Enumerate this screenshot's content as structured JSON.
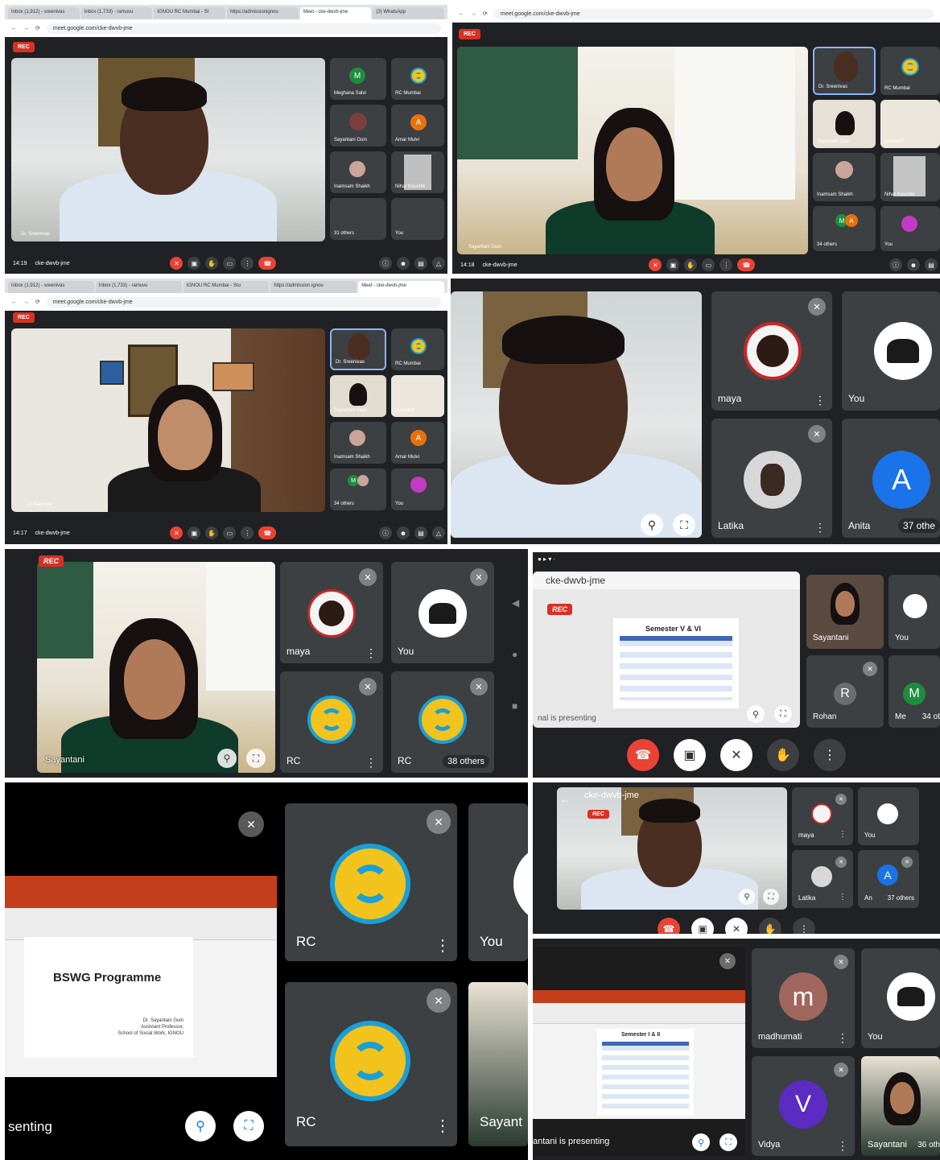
{
  "panel1": {
    "tabs": [
      "Inbox (1,912) - sreenivas",
      "Inbox (1,733) - ramuvu",
      "IGNOU RC Mumbai - St",
      "https://admissionignou",
      "Meet - cke-dwvb-jme",
      "(3) WhatsApp"
    ],
    "url": "meet.google.com/cke-dwvb-jme",
    "rec": "REC",
    "tiles": [
      {
        "name": "Meghana Salvi",
        "initial": "M",
        "color": "#1e8e3e"
      },
      {
        "name": "RC Mumbai",
        "initial": "",
        "color": "#3c4043"
      },
      {
        "name": "Sayantani Guin",
        "initial": "",
        "color": "#3c4043"
      },
      {
        "name": "Amar Mulvi",
        "initial": "A",
        "color": "#e8710a"
      },
      {
        "name": "Inamsam Shaikh",
        "initial": "",
        "color": "#3c4043"
      },
      {
        "name": "Nihar Kaushik",
        "initial": "",
        "color": "#3c4043"
      },
      {
        "name": "31 others",
        "initial": "",
        "color": "#3c4043"
      },
      {
        "name": "You",
        "initial": "",
        "color": "#3c4043"
      }
    ],
    "meeting_code": "cke-dwvb-jme",
    "time": "14:19"
  },
  "panel2": {
    "url": "meet.google.com/cke-dwvb-jme",
    "rec": "REC",
    "tiles": [
      "Dr. Sreenivas",
      "RC Mumbai",
      "Sayantani Guin",
      "prashant",
      "Inamsam Shaikh",
      "Nihar Kaushik",
      "34 others",
      "You"
    ],
    "main_name": "Sayantani Guin",
    "meeting_code": "cke-dwvb-jme",
    "time": "14:18"
  },
  "panel3": {
    "tabs": [
      "Inbox (1,912) - sreenivas",
      "Inbox (1,733) - ramuvu",
      "IGNOU RC Mumbai - Stu",
      "https://admission.ignou",
      "Meet - cke-dwvb-jme"
    ],
    "url": "meet.google.com/cke-dwvb-jme",
    "rec": "REC",
    "tiles": [
      "Dr. Sreenivas",
      "RC Mumbai",
      "Sayantani Guin",
      "prashant",
      "Inamsam Shaikh",
      "Amar Mulvi",
      "34 others",
      "You"
    ],
    "main_name": "Dr Saumya",
    "meeting_code": "cke-dwvb-jme",
    "time": "14:17"
  },
  "panel4": {
    "tiles": [
      {
        "name": "maya"
      },
      {
        "name": "You"
      },
      {
        "name": "Latika"
      },
      {
        "name": "Anita",
        "initial": "A",
        "others": "37 othe"
      }
    ]
  },
  "panel5": {
    "rec": "REC",
    "main_name": "Sayantani",
    "tiles": [
      {
        "name": "maya"
      },
      {
        "name": "You"
      },
      {
        "name": "RC"
      },
      {
        "name": "RC",
        "others": "38 others"
      }
    ]
  },
  "panel6": {
    "meeting_code": "cke-dwvb-jme",
    "rec": "REC",
    "slide_title": "Semester V & VI",
    "presenting": "nal is presenting",
    "tiles": [
      {
        "name": "Sayantani"
      },
      {
        "name": "You"
      },
      {
        "name": "Rohan",
        "initial": "R"
      },
      {
        "name": "Me",
        "initial": "M",
        "others": "34 ot"
      }
    ]
  },
  "panel7": {
    "ppt_title": "BSWG Programme",
    "ppt_sub": [
      "Dr. Sayantani Guin",
      "Assistant Professor,",
      "School of Social Work, IGNOU"
    ],
    "presenting": "senting",
    "tiles": [
      {
        "name": "RC"
      },
      {
        "name": "You"
      },
      {
        "name": "RC"
      },
      {
        "name": "Sayant"
      }
    ]
  },
  "panel8": {
    "meeting_code": "cke-dwvb-jme",
    "rec": "REC",
    "tiles": [
      {
        "name": "maya"
      },
      {
        "name": "You"
      },
      {
        "name": "Latika"
      },
      {
        "name": "An",
        "others": "37 others",
        "initial": "A"
      }
    ]
  },
  "panel9": {
    "slide_title": "Semester I & II",
    "presenting": "antani is presenting",
    "tiles": [
      {
        "name": "madhumati",
        "initial": "m"
      },
      {
        "name": "You"
      },
      {
        "name": "Vidya",
        "initial": "V"
      },
      {
        "name": "Sayantani",
        "others": "36 oth"
      }
    ]
  },
  "colors": {
    "meet_bg": "#202124",
    "tile_bg": "#3c4043",
    "red": "#ea4335",
    "rc_yellow": "#f2c31c",
    "rc_blue": "#1aa0d6",
    "ppt_red": "#c43e1c"
  },
  "icons": [
    "mic-off-icon",
    "pin-icon",
    "fullscreen-icon",
    "end-call-icon",
    "camera-off-icon",
    "raise-hand-icon",
    "more-icon",
    "present-icon",
    "chat-icon",
    "people-icon",
    "info-icon"
  ]
}
